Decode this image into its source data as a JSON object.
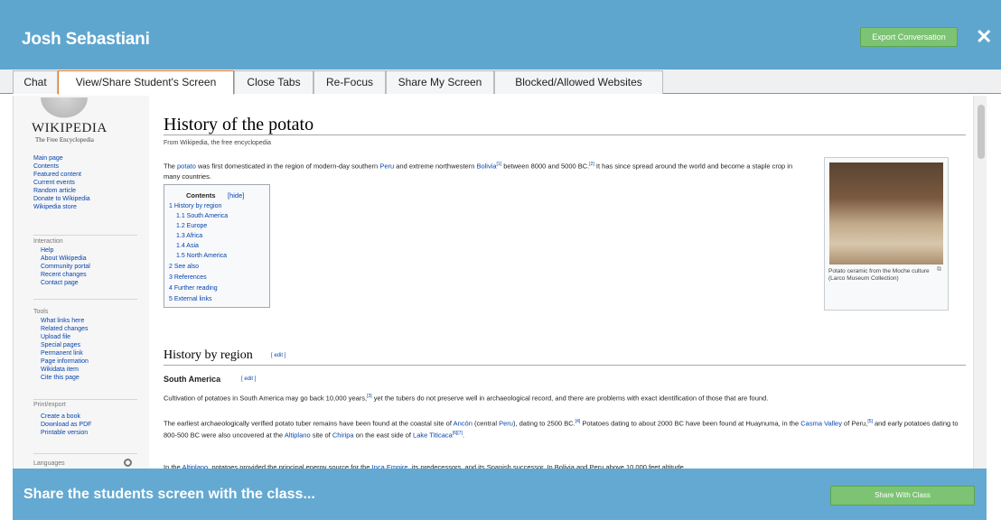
{
  "header": {
    "title": "Josh Sebastiani",
    "export_label": "Export Conversation",
    "close_label": "✕",
    "color": "#5fa6cf"
  },
  "tabs": [
    {
      "label": "Chat"
    },
    {
      "label": "View/Share Student's Screen"
    },
    {
      "label": "Close Tabs"
    },
    {
      "label": "Re-Focus"
    },
    {
      "label": "Share My Screen"
    },
    {
      "label": "Blocked/Allowed Websites"
    }
  ],
  "active_tab": "View/Share Student's Screen",
  "wiki": {
    "wordmark": "WIKIPEDIA",
    "tagline": "The Free Encyclopedia",
    "nav_main": [
      "Main page",
      "Contents",
      "Featured content",
      "Current events",
      "Random article",
      "Donate to Wikipedia",
      "Wikipedia store"
    ],
    "interaction_head": "Interaction",
    "interaction": [
      "Help",
      "About Wikipedia",
      "Community portal",
      "Recent changes",
      "Contact page"
    ],
    "tools_head": "Tools",
    "tools": [
      "What links here",
      "Related changes",
      "Upload file",
      "Special pages",
      "Permanent link",
      "Page information",
      "Wikidata item",
      "Cite this page"
    ],
    "print_head": "Print/export",
    "print": [
      "Create a book",
      "Download as PDF",
      "Printable version"
    ],
    "languages_head": "Languages"
  },
  "article": {
    "title": "History of the potato",
    "from": "From Wikipedia, the free encyclopedia",
    "intro": {
      "t1": "The ",
      "l1": "potato",
      "t2": " was first domesticated in the region of modern-day southern ",
      "l2": "Peru",
      "t3": " and extreme northwestern ",
      "l3": "Bolivia",
      "s1": "[1]",
      "t4": " between 8000 and 5000 BC.",
      "s2": "[2]",
      "t5": " It has since spread around the world and become a staple crop in many countries."
    },
    "toc": {
      "title": "Contents",
      "hide": "[hide]",
      "items": [
        "1 History by region",
        "1.1 South America",
        "1.2 Europe",
        "1.3 Africa",
        "1.4 Asia",
        "1.5 North America",
        "2 See also",
        "3 References",
        "4 Further reading",
        "5 External links"
      ]
    },
    "figure": {
      "caption": "Potato ceramic from the Moche culture (Larco Museum Collection)"
    },
    "h2": "History by region",
    "edit": "[ edit ]",
    "h3": "South America",
    "p1": {
      "t1": "Cultivation of potatoes in South America may go back 10,000 years,",
      "s1": "[3]",
      "t2": " yet the tubers do not preserve well in archaeological record, and there are problems with exact identification of those that are found."
    },
    "p2": {
      "t1": "The earliest archaeologically verified potato tuber remains have been found at the coastal site of ",
      "l1": "Ancón",
      "t2": " (central ",
      "l2": "Peru",
      "t3": "), dating to 2500 BC.",
      "s1": "[4]",
      "t4": " Potatoes dating to about 2000 BC have been found at Huaynuma, in the ",
      "l3": "Casma Valley",
      "t5": " of Peru,",
      "s2": "[5]",
      "t6": " and early potatoes dating to 800-500 BC were also uncovered at the ",
      "l4": "Altiplano",
      "t7": " site of ",
      "l5": "Chiripa",
      "t8": " on the east side of ",
      "l6": "Lake Titicaca",
      "s3": "[6][7]",
      "t9": "."
    },
    "p3": {
      "t1": "In the ",
      "l1": "Altiplano",
      "t2": ", potatoes provided the principal energy source for the ",
      "l2": "Inca Empire",
      "t3": ", its predecessors, and its Spanish successor. In Bolivia and Peru above 10,000 feet altitude"
    }
  },
  "share": {
    "text": "Share the students screen with the class...",
    "button": "Share With Class"
  },
  "accent_color": "#e07a30",
  "button_color": "#7cc373"
}
